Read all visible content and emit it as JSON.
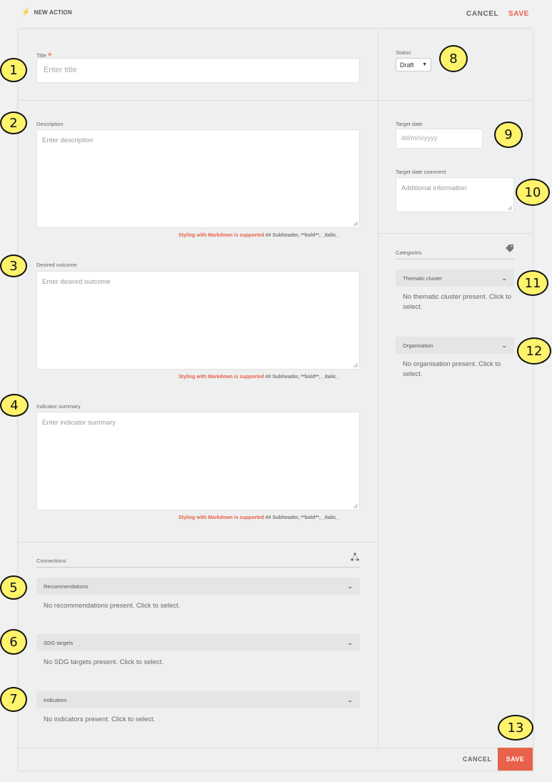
{
  "header": {
    "title": "NEW ACTION",
    "cancel_label": "CANCEL",
    "save_label": "SAVE"
  },
  "form": {
    "title_label": "Title",
    "required_mark": "*",
    "title_placeholder": "Enter title",
    "description_label": "Description",
    "description_placeholder": "Enter description",
    "desired_outcome_label": "Desired outcome",
    "desired_outcome_placeholder": "Enter desired outcome",
    "indicator_summary_label": "Indicator summary",
    "indicator_summary_placeholder": "Enter indicator summary",
    "markdown_hint_highlight": "Styling with Markdown is supported",
    "markdown_hint_rest": "## Subheader, **bold**, _italic_"
  },
  "connections": {
    "heading": "Connections",
    "items": [
      {
        "label": "Recommendations",
        "empty": "No recommendations present. Click to select."
      },
      {
        "label": "SDG targets",
        "empty": "No SDG targets present. Click to select."
      },
      {
        "label": "Indicators",
        "empty": "No indicators present. Click to select."
      }
    ]
  },
  "sidebar": {
    "status_label": "Status",
    "status_value": "Draft",
    "target_date_label": "Target date",
    "target_date_placeholder": "dd/mm/yyyy",
    "target_date_comment_label": "Target date comment",
    "target_date_comment_placeholder": "Additional information",
    "categories_heading": "Categories",
    "categories": [
      {
        "label": "Thematic cluster",
        "empty": "No thematic cluster present. Click to select."
      },
      {
        "label": "Organisation",
        "empty": "No organisation present. Click to select."
      }
    ]
  },
  "footer": {
    "cancel_label": "CANCEL",
    "save_label": "SAVE"
  },
  "annotations": [
    "1",
    "2",
    "3",
    "4",
    "5",
    "6",
    "7",
    "8",
    "9",
    "10",
    "11",
    "12",
    "13"
  ],
  "colors": {
    "accent": "#e8614a",
    "badge": "#fff36b",
    "page_bg": "#f1f1f1",
    "card_bg": "#eef0f0"
  },
  "icons": {
    "header": "bolt-icon",
    "connections": "network-icon",
    "categories": "tag-icon",
    "accordion": "chevron-down-icon"
  }
}
